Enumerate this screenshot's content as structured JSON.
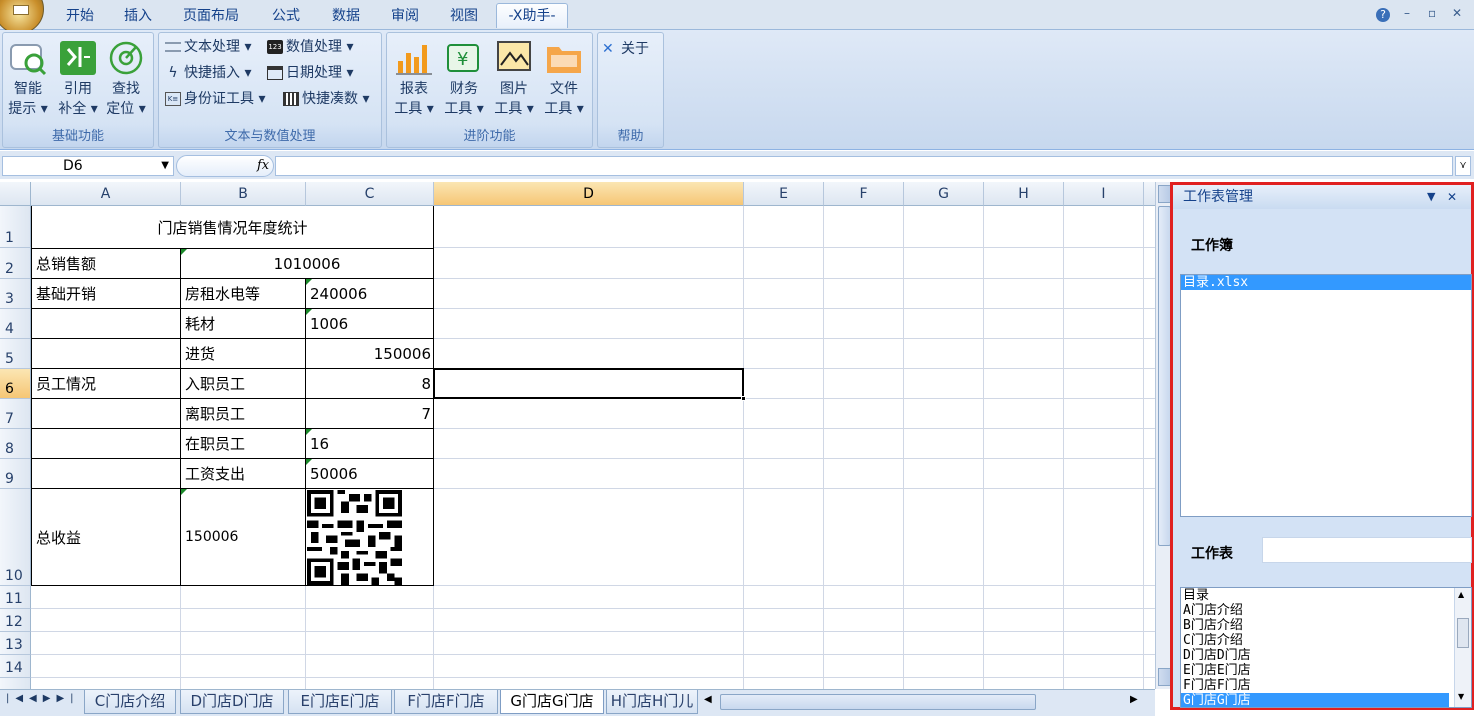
{
  "tabs": [
    "开始",
    "插入",
    "页面布局",
    "公式",
    "数据",
    "审阅",
    "视图",
    "-X助手-"
  ],
  "window_controls": {
    "help": "?",
    "minimize": "–",
    "restore": "▫",
    "close": "✕"
  },
  "ribbon": {
    "groups": [
      {
        "title": "基础功能",
        "buttons": [
          {
            "l1": "智能",
            "l2": "提示 ▾"
          },
          {
            "l1": "引用",
            "l2": "补全 ▾"
          },
          {
            "l1": "查找",
            "l2": "定位 ▾"
          }
        ]
      },
      {
        "title": "文本与数值处理",
        "items": [
          "文本处理 ▾",
          "快捷插入 ▾",
          "身份证工具 ▾",
          "数值处理 ▾",
          "日期处理 ▾",
          "快捷凑数 ▾"
        ]
      },
      {
        "title": "进阶功能",
        "buttons": [
          {
            "l1": "报表",
            "l2": "工具 ▾"
          },
          {
            "l1": "财务",
            "l2": "工具 ▾"
          },
          {
            "l1": "图片",
            "l2": "工具 ▾"
          },
          {
            "l1": "文件",
            "l2": "工具 ▾"
          }
        ]
      },
      {
        "title": "帮助",
        "about": "关于"
      }
    ]
  },
  "formula_bar": {
    "name_box": "D6",
    "fx": "fx",
    "formula": ""
  },
  "columns": [
    "A",
    "B",
    "C",
    "D",
    "E",
    "F",
    "G",
    "H",
    "I"
  ],
  "rows": [
    "1",
    "2",
    "3",
    "4",
    "5",
    "6",
    "7",
    "8",
    "9",
    "10",
    "11",
    "12",
    "13",
    "14"
  ],
  "cells": {
    "title": "门店销售情况年度统计",
    "a2": "总销售额",
    "bc2": "1010006",
    "a3": "基础开销",
    "b3": "房租水电等",
    "c3": "240006",
    "b4": "耗材",
    "c4": "1006",
    "b5": "进货",
    "c5": "150006",
    "a6": "员工情况",
    "b6": "入职员工",
    "c6": "8",
    "b7": "离职员工",
    "c7": "7",
    "b8": "在职员工",
    "c8": "16",
    "b9": "工资支出",
    "c9": "50006",
    "a10": "总收益",
    "b10": "150006"
  },
  "sheet_tabs": [
    "C门店介绍",
    "D门店D门店",
    "E门店E门店",
    "F门店F门店",
    "G门店G门店",
    "H门店H门儿"
  ],
  "active_sheet_index": 4,
  "panel": {
    "title": "工作表管理",
    "workbook_label": "工作簿",
    "workbooks": [
      "目录.xlsx"
    ],
    "sheet_label": "工作表",
    "sheet_search": "",
    "sheets": [
      "目录",
      "A门店介绍",
      "B门店介绍",
      "C门店介绍",
      "D门店D门店",
      "E门店E门店",
      "F门店F门店",
      "G门店G门店"
    ],
    "selected_sheet_index": 7
  },
  "colors": {
    "accent": "#3399ff",
    "panel_border": "#e02020",
    "selected_header": "#f6c675"
  }
}
